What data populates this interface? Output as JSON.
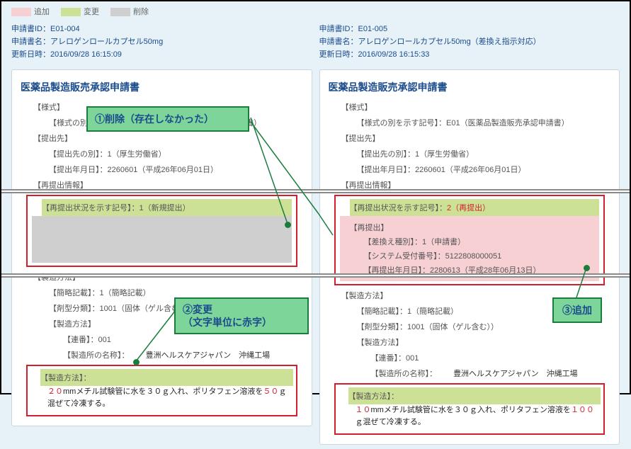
{
  "legend": {
    "add": "追加",
    "mod": "変更",
    "del": "削除"
  },
  "left": {
    "id_label": "申請書ID：",
    "id": "E01-004",
    "name_label": "申請書名：",
    "name": "アレロゲンロールカプセル50mg",
    "updated_label": "更新日時：",
    "updated": "2016/09/28 16:15:09",
    "card_title": "医薬品製造販売承認申請書",
    "f_format": "【様式】",
    "f_format_kind": "【様式の別を示す記号】：E01（医薬品製造販売承認申請書）",
    "f_dest": "【提出先】",
    "f_dest_kind": "【提出先の別】：1（厚生労働省）",
    "f_submit_date": "【提出年月日】：2260601（平成26年06月01日）",
    "f_resubmit": "【再提出情報】",
    "f_resubmit_status": "【再提出状況を示す記号】：1（新規提出）",
    "f_method": "【製造方法】",
    "f_brief": "【簡略記載】：1（簡略記載）",
    "f_form": "【剤型分類】：1001（固体（ゲル含む））",
    "f_method2": "【製造方法】",
    "f_seq": "【連番】：001",
    "f_site": "【製造所の名称】：",
    "f_site_val": "豊洲ヘルスケアジャパン　沖縄工場",
    "f_proc": "【製造方法】：",
    "f_proc_val_a": "２０",
    "f_proc_val_b": "mmメチル試験管に水を３０ｇ入れ、ポリタフェン溶液を",
    "f_proc_val_c": "５０",
    "f_proc_val_d": "ｇ混ぜて冷凍する。"
  },
  "right": {
    "id_label": "申請書ID：",
    "id": "E01-005",
    "name_label": "申請書名：",
    "name": "アレロゲンロールカプセル50mg（差換え指示対応）",
    "updated_label": "更新日時：",
    "updated": "2016/09/28 16:15:33",
    "card_title": "医薬品製造販売承認申請書",
    "f_format": "【様式】",
    "f_format_kind": "【様式の別を示す記号】：E01（医薬品製造販売承認申請書）",
    "f_dest": "【提出先】",
    "f_dest_kind": "【提出先の別】：1（厚生労働省）",
    "f_submit_date": "【提出年月日】：2260601（平成26年06月01日）",
    "f_resubmit": "【再提出情報】",
    "f_resubmit_status_a": "【再提出状況を示す記号】：",
    "f_resubmit_status_b": "2（再提出）",
    "f_resubmit_hdr": "【再提出】",
    "f_replace_kind": "【差換え種別】：1（申請書）",
    "f_sys_no": "【システム受付番号】：5122808000051",
    "f_resubmit_date": "【再提出年月日】：2280613（平成28年06月13日）",
    "f_method": "【製造方法】",
    "f_brief": "【簡略記載】：1（簡略記載）",
    "f_form": "【剤型分類】：1001（固体（ゲル含む））",
    "f_method2": "【製造方法】",
    "f_seq": "【連番】：001",
    "f_site": "【製造所の名称】：",
    "f_site_val": "豊洲ヘルスケアジャパン　沖縄工場",
    "f_proc": "【製造方法】：",
    "f_proc_val_a": "１０",
    "f_proc_val_b": "mmメチル試験管に水を３０ｇ入れ、ポリタフェン溶液を",
    "f_proc_val_c": "１００",
    "f_proc_val_d": "ｇ混ぜて冷凍する。"
  },
  "callouts": {
    "c1": "①削除（存在しなかった）",
    "c2a": "②変更",
    "c2b": "（文字単位に赤字）",
    "c3": "③追加"
  }
}
